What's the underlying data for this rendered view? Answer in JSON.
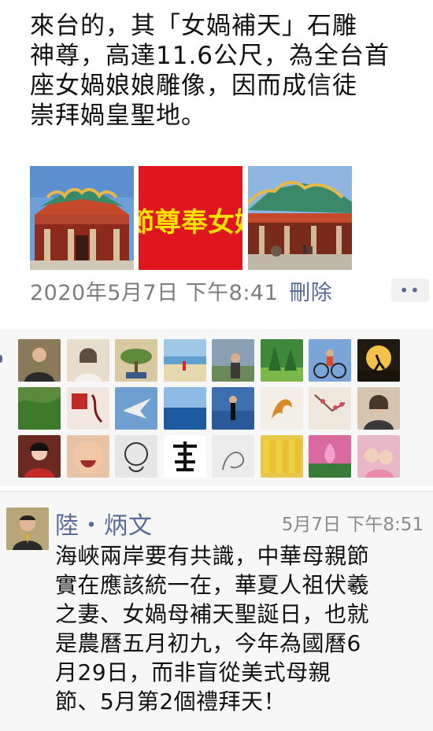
{
  "post": {
    "text_lines": [
      "來台的，其「女媧補天」石雕",
      "神尊，高達11.6公尺，為全台首",
      "座女媧娘娘雕像，因而成信徒",
      "崇拜媧皇聖地。"
    ],
    "images": [
      {
        "icon": "temple-roof-photo"
      },
      {
        "icon": "red-banner-photo",
        "banner_text": "節尊奉女媧"
      },
      {
        "icon": "temple-courtyard-photo"
      }
    ],
    "date": "2020年5月7日 下午8:41",
    "delete_label": "刪除",
    "more_label": "••"
  },
  "likes": {
    "avatars": [
      {
        "icon": "man-portrait-avatar",
        "bg": "#8a7a5a"
      },
      {
        "icon": "woman-portrait-avatar",
        "bg": "#e8dccb"
      },
      {
        "icon": "bonsai-avatar",
        "bg": "#d8c9a0"
      },
      {
        "icon": "beach-avatar",
        "bg": "#9ec8e6"
      },
      {
        "icon": "man-outdoor-avatar",
        "bg": "#8aa0b4"
      },
      {
        "icon": "forest-avatar",
        "bg": "#3f8a3a"
      },
      {
        "icon": "cyclist-avatar",
        "bg": "#7aa5d8"
      },
      {
        "icon": "runner-sunset-avatar",
        "bg": "#1f1a12"
      },
      {
        "icon": "moss-avatar",
        "bg": "#5a8a3a"
      },
      {
        "icon": "calligraphy-seal-avatar",
        "bg": "#f2e6e0"
      },
      {
        "icon": "bird-sky-avatar",
        "bg": "#6f9fd0"
      },
      {
        "icon": "ocean-horizon-avatar",
        "bg": "#2f6fb8"
      },
      {
        "icon": "woman-sea-avatar",
        "bg": "#3e6fae"
      },
      {
        "icon": "phoenix-art-avatar",
        "bg": "#f4efe6"
      },
      {
        "icon": "plum-blossom-avatar",
        "bg": "#efe7dc"
      },
      {
        "icon": "woman-portrait-2-avatar",
        "bg": "#d7c4b0"
      },
      {
        "icon": "woman-red-avatar",
        "bg": "#6a2a22"
      },
      {
        "icon": "laughing-face-avatar",
        "bg": "#e9c3a6"
      },
      {
        "icon": "monk-sketch-avatar",
        "bg": "#e6e6e6"
      },
      {
        "icon": "calligraphy-character-avatar",
        "bg": "#ffffff"
      },
      {
        "icon": "ink-sketch-avatar",
        "bg": "#ececec"
      },
      {
        "icon": "book-set-avatar",
        "bg": "#e8c84a"
      },
      {
        "icon": "lotus-avatar",
        "bg": "#d86aa0"
      },
      {
        "icon": "children-avatar",
        "bg": "#e8b8c8"
      }
    ]
  },
  "comment": {
    "author": "陸・炳文",
    "time": "5月7日 下午8:51",
    "avatar_icon": "man-portrait-avatar",
    "body_lines": [
      "海峽兩岸要有共識，中華母親節",
      "實在應該統一在，華夏人祖伏羲",
      "之妻、女媧母補天聖誕日，也就",
      "是農曆五月初九，今年為國曆6",
      "月29日，而非盲從美式母親",
      "節、5月第2個禮拜天！"
    ]
  },
  "colors": {
    "link": "#586b94",
    "meta": "#7d7d7d",
    "panel": "#f7f7f7",
    "banner_red": "#e0161f",
    "banner_yellow": "#ffe100"
  }
}
